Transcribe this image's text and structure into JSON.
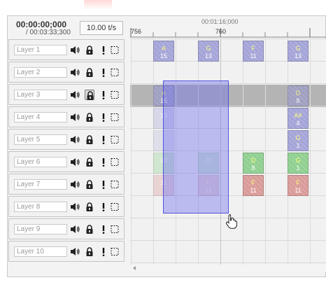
{
  "time": {
    "current": "00:00:00;000",
    "total": "/ 00:03:33;300"
  },
  "speed": "10.00 t/s",
  "ruler": {
    "time_label": "00:01:16;000",
    "ticks": [
      "756",
      "760"
    ]
  },
  "layers": [
    {
      "name": "Layer 1"
    },
    {
      "name": "Layer 2"
    },
    {
      "name": "Layer 3"
    },
    {
      "name": "Layer 4"
    },
    {
      "name": "Layer 5"
    },
    {
      "name": "Layer 6"
    },
    {
      "name": "Layer 7"
    },
    {
      "name": "Layer 8"
    },
    {
      "name": "Layer 9"
    },
    {
      "name": "Layer 10"
    }
  ],
  "clips": {
    "layer1": [
      {
        "note": "A",
        "val": "15"
      },
      {
        "note": "G",
        "val": "13"
      },
      {
        "note": "F",
        "val": "11"
      },
      {
        "note": "G",
        "val": "13"
      }
    ],
    "layer3": [
      {
        "note": "A",
        "val": "15"
      },
      {
        "note": "D",
        "val": "8"
      }
    ],
    "layer4": [
      {
        "note": "",
        "val": "13"
      },
      {
        "note": "A#",
        "val": "4"
      }
    ],
    "layer5": [
      {
        "note": "",
        "val": ""
      },
      {
        "note": "G",
        "val": "1"
      }
    ],
    "layer6": [
      {
        "note": "",
        "val": "20"
      },
      {
        "note": "",
        "val": "20"
      },
      {
        "note": "D",
        "val": "8"
      },
      {
        "note": "G",
        "val": "1"
      }
    ],
    "layer7": [
      {
        "note": "",
        "val": "11"
      },
      {
        "note": "F",
        "val": "11"
      },
      {
        "note": "F",
        "val": "11"
      },
      {
        "note": "F",
        "val": "11"
      }
    ]
  },
  "colors": {
    "clip_purple": "#a4a4d8",
    "clip_green": "#8fcf90",
    "clip_red": "#d99b98",
    "note_text": "#ffff80",
    "selection": "#7070ee"
  },
  "icons": {
    "speaker": "speaker-icon",
    "lock": "lock-icon",
    "alert": "exclamation-icon",
    "select": "select-box-icon",
    "cursor": "hand-pointer-icon"
  }
}
